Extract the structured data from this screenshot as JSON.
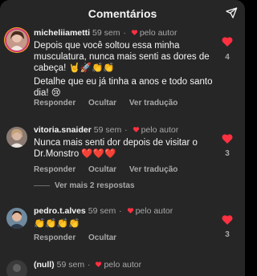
{
  "header": {
    "title": "Comentários"
  },
  "comments": [
    {
      "username": "micheliiametti",
      "time": "59 sem",
      "author_label": "pelo autor",
      "paragraphs": [
        "Depois que você soltou essa minha musculatura, nunca mais senti as dores de cabeça! 🤘🚀👏👏",
        "Detalhe que eu já tinha a anos e todo santo dia! 😢"
      ],
      "actions": [
        "Responder",
        "Ocultar",
        "Ver tradução"
      ],
      "likes": "4"
    },
    {
      "username": "vitoria.snaider",
      "time": "59 sem",
      "author_label": "pelo autor",
      "paragraphs": [
        "Nunca mais senti dor depois de visitar o Dr.Monstro ❤️❤️❤️"
      ],
      "actions": [
        "Responder",
        "Ocultar",
        "Ver tradução"
      ],
      "likes": "3",
      "more_replies": "Ver mais 2 respostas"
    },
    {
      "username": "pedro.t.alves",
      "time": "59 sem",
      "author_label": "pelo autor",
      "paragraphs": [
        "👏👏👏👏"
      ],
      "actions": [
        "Responder",
        "Ocultar"
      ],
      "likes": "3"
    },
    {
      "username": "(null)",
      "time": "59 sem",
      "author_label": "pelo autor"
    }
  ],
  "colors": {
    "background": "#262626",
    "text": "#f5f5f5",
    "secondary": "#a8a8a8",
    "heart": "#ff3040"
  }
}
